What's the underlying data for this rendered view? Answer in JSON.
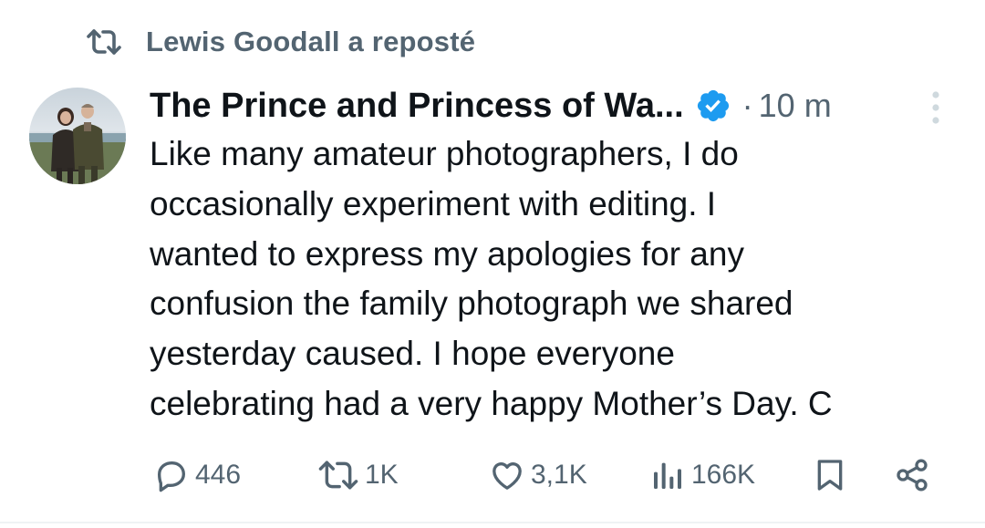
{
  "repost": {
    "label": "Lewis Goodall a reposté",
    "icon": "repost-icon"
  },
  "author": {
    "name": "The Prince and Princess of Wa...",
    "verified": true,
    "verified_color": "#1d9bf0",
    "avatar_icon": "avatar-photo"
  },
  "meta": {
    "separator": "·",
    "timestamp": "10 m"
  },
  "tweet": {
    "lines": [
      "Like many amateur photographers, I do",
      "occasionally experiment with editing. I",
      "wanted to express my apologies for any",
      "confusion the family photograph we shared",
      "yesterday caused. I hope everyone",
      "celebrating had a very happy Mother’s Day. C"
    ]
  },
  "actions": {
    "replies": "446",
    "reposts": "1K",
    "likes": "3,1K",
    "views": "166K",
    "icons": [
      "reply-icon",
      "repost-icon",
      "like-icon",
      "views-icon",
      "bookmark-icon",
      "share-icon"
    ]
  },
  "colors": {
    "text": "#0f1419",
    "secondary": "#536471",
    "more_dots": "#cfd9de",
    "accent": "#1d9bf0"
  }
}
